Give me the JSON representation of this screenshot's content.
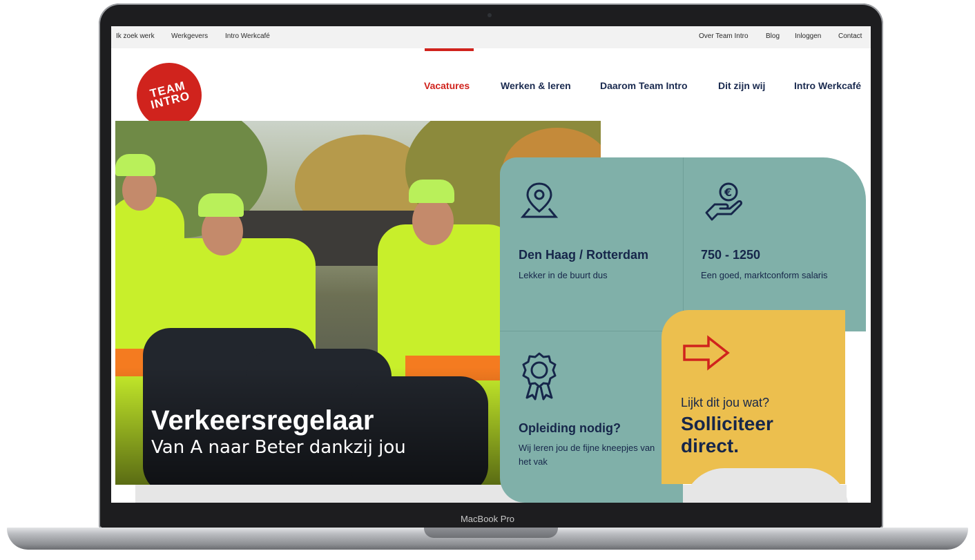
{
  "device": {
    "label": "MacBook Pro"
  },
  "topbar": {
    "left": [
      "Ik zoek werk",
      "Werkgevers",
      "Intro Werkcafé"
    ],
    "right": [
      "Over Team Intro",
      "Blog",
      "Inloggen",
      "Contact"
    ]
  },
  "logo": {
    "line1": "TEAM",
    "line2": "INTRO"
  },
  "mainnav": [
    "Vacatures",
    "Werken & leren",
    "Daarom Team Intro",
    "Dit zijn wij",
    "Intro Werkcafé"
  ],
  "mainnav_active": "Vacatures",
  "hero": {
    "title": "Verkeersregelaar",
    "subtitle": "Van A naar Beter dankzij jou"
  },
  "cards": [
    {
      "icon": "location-pin-icon",
      "title": "Den Haag / Rotterdam",
      "text": "Lekker in de buurt dus"
    },
    {
      "icon": "salary-hand-euro-icon",
      "title": "750 - 1250",
      "text": "Een goed, marktconform salaris"
    },
    {
      "icon": "award-ribbon-icon",
      "title": "Opleiding nodig?",
      "text": "Wij leren jou de fijne kneepjes van het vak"
    }
  ],
  "apply": {
    "icon": "arrow-right-icon",
    "question": "Lijkt dit jou wat?",
    "cta": "Solliciteer direct."
  },
  "colors": {
    "brand_red": "#d0231d",
    "navy": "#16264a",
    "teal": "#80b0a9",
    "yellow": "#ecbf4e"
  }
}
